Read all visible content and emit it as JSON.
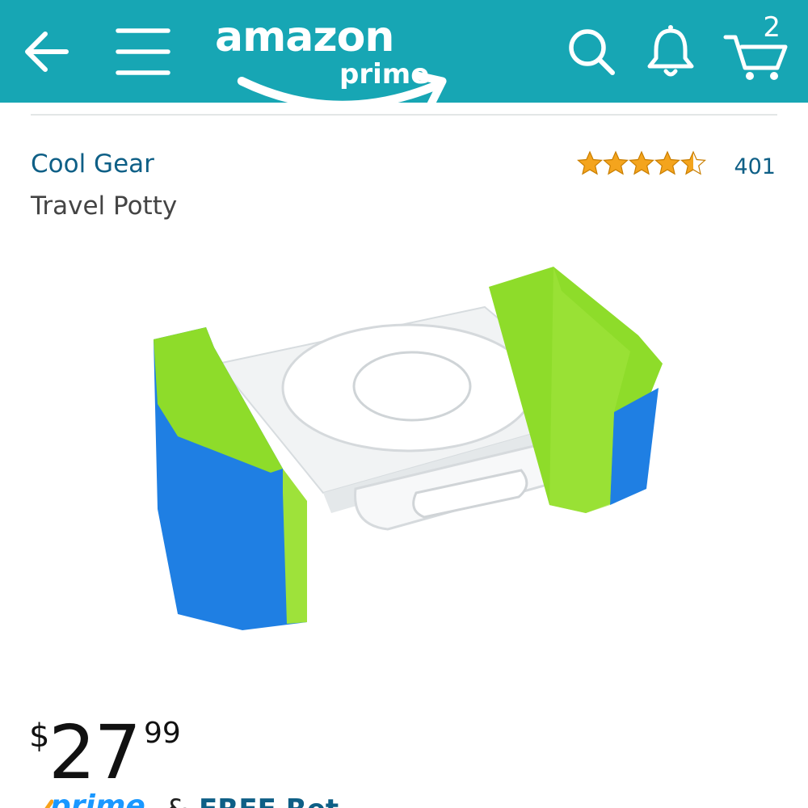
{
  "app": {
    "logo_word": "amazon",
    "logo_sub": "prime",
    "cart_count": "2",
    "colors": {
      "header_bg": "#17a6b4",
      "link": "#0e5f86",
      "star": "#f4a41d"
    },
    "icons": [
      "back-arrow-icon",
      "menu-icon",
      "search-icon",
      "bell-icon",
      "cart-icon"
    ]
  },
  "product": {
    "brand": "Cool Gear",
    "title": "Travel Potty",
    "rating": 4.5,
    "review_count": "401",
    "price": {
      "currency": "$",
      "whole": "27",
      "fraction": "99"
    },
    "shipping": {
      "prime_label": "prime",
      "connector": "&",
      "text": "FREE Ret"
    }
  }
}
